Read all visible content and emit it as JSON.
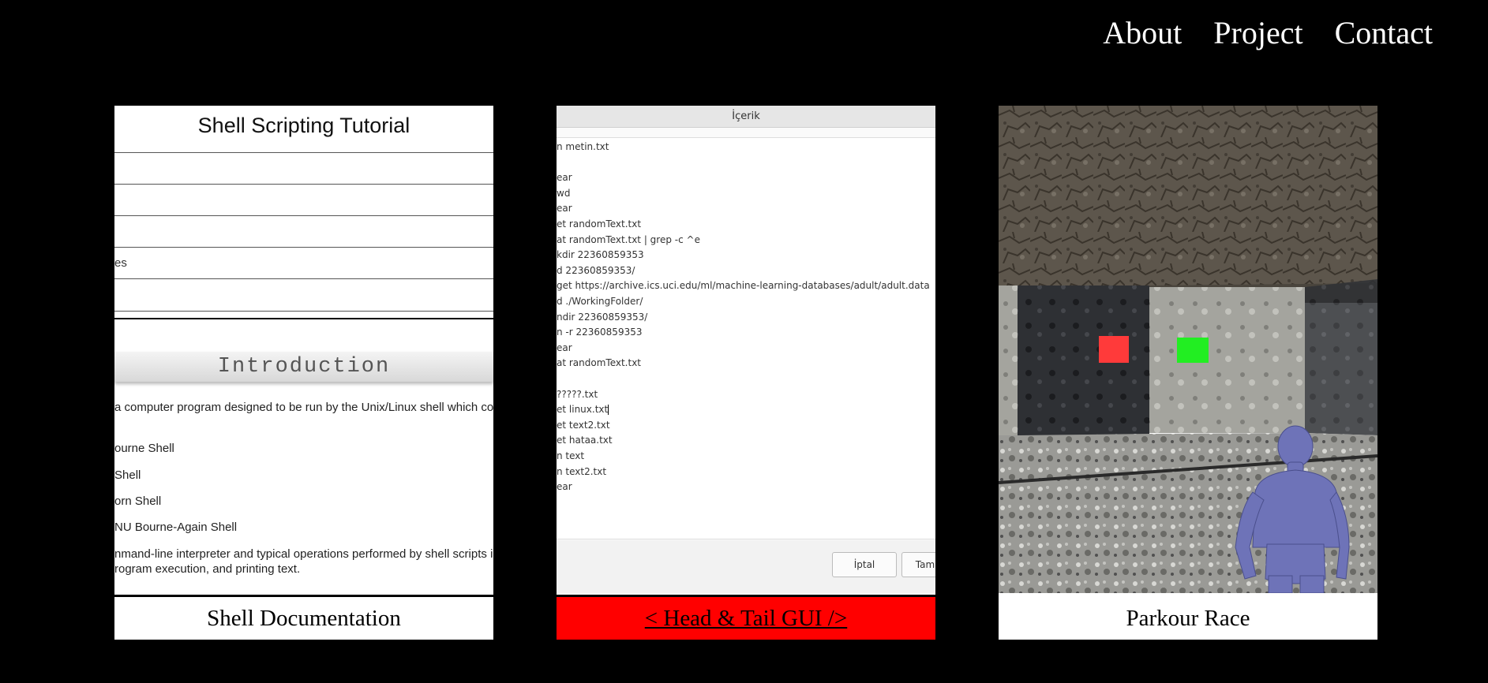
{
  "nav": {
    "items": [
      "About",
      "Project",
      "Contact"
    ]
  },
  "cards": [
    {
      "caption": "Shell Documentation",
      "doc": {
        "title": "Shell Scripting Tutorial",
        "row_text": "es",
        "intro_heading": "Introduction",
        "paragraph_1": "a computer program designed to be run by the Unix/Linux shell which co",
        "list": [
          "ourne Shell",
          "Shell",
          "orn Shell",
          "NU Bourne-Again Shell"
        ],
        "paragraph_2_line1": "nmand-line interpreter and typical operations performed by shell scripts in",
        "paragraph_2_line2": "rogram execution, and printing text."
      }
    },
    {
      "caption": "< Head & Tail GUI />",
      "caption_color": "#ff0000",
      "dialog": {
        "title": "İçerik",
        "lines": [
          "n metin.txt",
          "",
          "ear",
          "wd",
          "ear",
          "et randomText.txt",
          "at randomText.txt | grep -c ^e",
          "kdir 22360859353",
          "d 22360859353/",
          "get https://archive.ics.uci.edu/ml/machine-learning-databases/adult/adult.data",
          "d ./WorkingFolder/",
          "ndir 22360859353/",
          "n -r 22360859353",
          "ear",
          "at randomText.txt",
          "",
          " ?????.txt",
          "et linux.txt",
          "et text2.txt",
          "et hataa.txt",
          "n text",
          "n text2.txt",
          "ear"
        ],
        "cancel_label": "İptal",
        "ok_label": "Tam"
      }
    },
    {
      "caption": "Parkour Race"
    }
  ]
}
